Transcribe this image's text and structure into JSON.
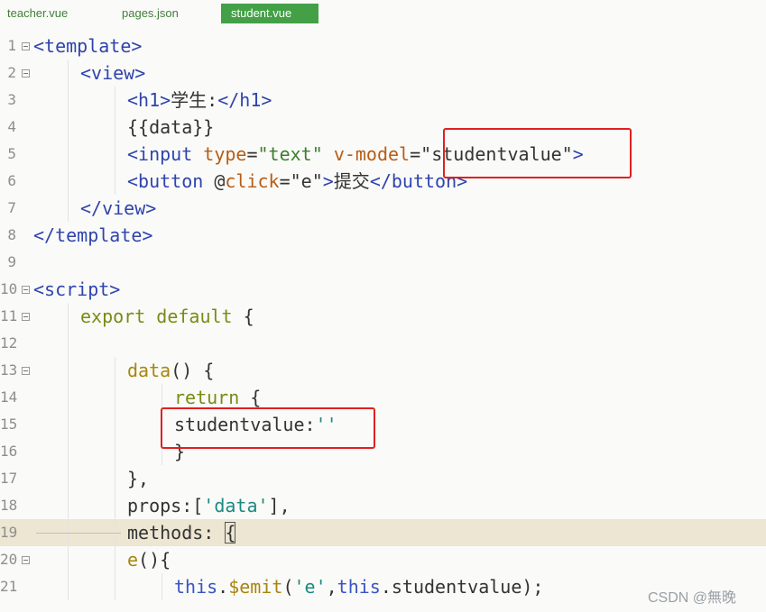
{
  "tabs": [
    {
      "label": "teacher.vue",
      "active": false
    },
    {
      "label": "pages.json",
      "active": false
    },
    {
      "label": "student.vue",
      "active": true
    }
  ],
  "lines": [
    {
      "n": "1",
      "fold": true,
      "indent": 0,
      "tokens": [
        [
          "tag",
          "<template>"
        ]
      ]
    },
    {
      "n": "2",
      "fold": true,
      "indent": 1,
      "tokens": [
        [
          "tag",
          "<view>"
        ]
      ]
    },
    {
      "n": "3",
      "fold": false,
      "indent": 2,
      "tokens": [
        [
          "tag",
          "<h1>"
        ],
        [
          "",
          "学生:"
        ],
        [
          "tag",
          "</h1>"
        ]
      ]
    },
    {
      "n": "4",
      "fold": false,
      "indent": 2,
      "tokens": [
        [
          "",
          "{{data}}"
        ]
      ]
    },
    {
      "n": "5",
      "fold": false,
      "indent": 2,
      "tokens": [
        [
          "tag",
          "<input "
        ],
        [
          "attr",
          "type"
        ],
        [
          "",
          "="
        ],
        [
          "val",
          "\"text\""
        ],
        [
          "",
          " "
        ],
        [
          "attr",
          "v-model"
        ],
        [
          "",
          "=\"studentvalue\""
        ],
        [
          "tag",
          ">"
        ]
      ]
    },
    {
      "n": "6",
      "fold": false,
      "indent": 2,
      "tokens": [
        [
          "tag",
          "<button "
        ],
        [
          "",
          "@"
        ],
        [
          "attr",
          "click"
        ],
        [
          "",
          "=\"e\""
        ],
        [
          "tag",
          ">"
        ],
        [
          "",
          "提交"
        ],
        [
          "tag",
          "</button>"
        ]
      ]
    },
    {
      "n": "7",
      "fold": false,
      "indent": 1,
      "tokens": [
        [
          "tag",
          "</view>"
        ]
      ]
    },
    {
      "n": "8",
      "fold": false,
      "indent": 0,
      "tokens": [
        [
          "tag",
          "</template>"
        ]
      ]
    },
    {
      "n": "9",
      "fold": false,
      "indent": 0,
      "tokens": []
    },
    {
      "n": "10",
      "fold": true,
      "indent": 0,
      "tokens": [
        [
          "tag",
          "<script>"
        ]
      ]
    },
    {
      "n": "11",
      "fold": true,
      "indent": 1,
      "tokens": [
        [
          "kw",
          "export default"
        ],
        [
          "",
          " {"
        ]
      ]
    },
    {
      "n": "12",
      "fold": false,
      "indent": 1,
      "tokens": []
    },
    {
      "n": "13",
      "fold": true,
      "indent": 2,
      "tokens": [
        [
          "fn",
          "data"
        ],
        [
          "",
          "() {"
        ]
      ]
    },
    {
      "n": "14",
      "fold": false,
      "indent": 3,
      "tokens": [
        [
          "kw",
          "return"
        ],
        [
          "",
          " {"
        ]
      ]
    },
    {
      "n": "15",
      "fold": false,
      "indent": 3,
      "tokens": [
        [
          "",
          "studentvalue:"
        ],
        [
          "str",
          "''"
        ]
      ]
    },
    {
      "n": "16",
      "fold": false,
      "indent": 3,
      "tokens": [
        [
          "",
          "}"
        ]
      ]
    },
    {
      "n": "17",
      "fold": false,
      "indent": 2,
      "tokens": [
        [
          "",
          "},"
        ]
      ]
    },
    {
      "n": "18",
      "fold": false,
      "indent": 2,
      "tokens": [
        [
          "",
          "props:["
        ],
        [
          "str",
          "'data'"
        ],
        [
          "",
          "],"
        ]
      ]
    },
    {
      "n": "19",
      "fold": false,
      "indent": 2,
      "highlight": true,
      "tokens": [
        [
          "",
          "methods: "
        ],
        [
          "cur",
          "{"
        ]
      ]
    },
    {
      "n": "20",
      "fold": true,
      "indent": 2,
      "tokens": [
        [
          "fn",
          "e"
        ],
        [
          "",
          "(){"
        ]
      ]
    },
    {
      "n": "21",
      "fold": false,
      "indent": 3,
      "tokens": [
        [
          "this",
          "this"
        ],
        [
          "",
          "."
        ],
        [
          "fn",
          "$emit"
        ],
        [
          "",
          "("
        ],
        [
          "str",
          "'e'"
        ],
        [
          "",
          ","
        ],
        [
          "this",
          "this"
        ],
        [
          "",
          ".studentvalue);"
        ]
      ]
    }
  ],
  "watermark": "CSDN @無晚"
}
